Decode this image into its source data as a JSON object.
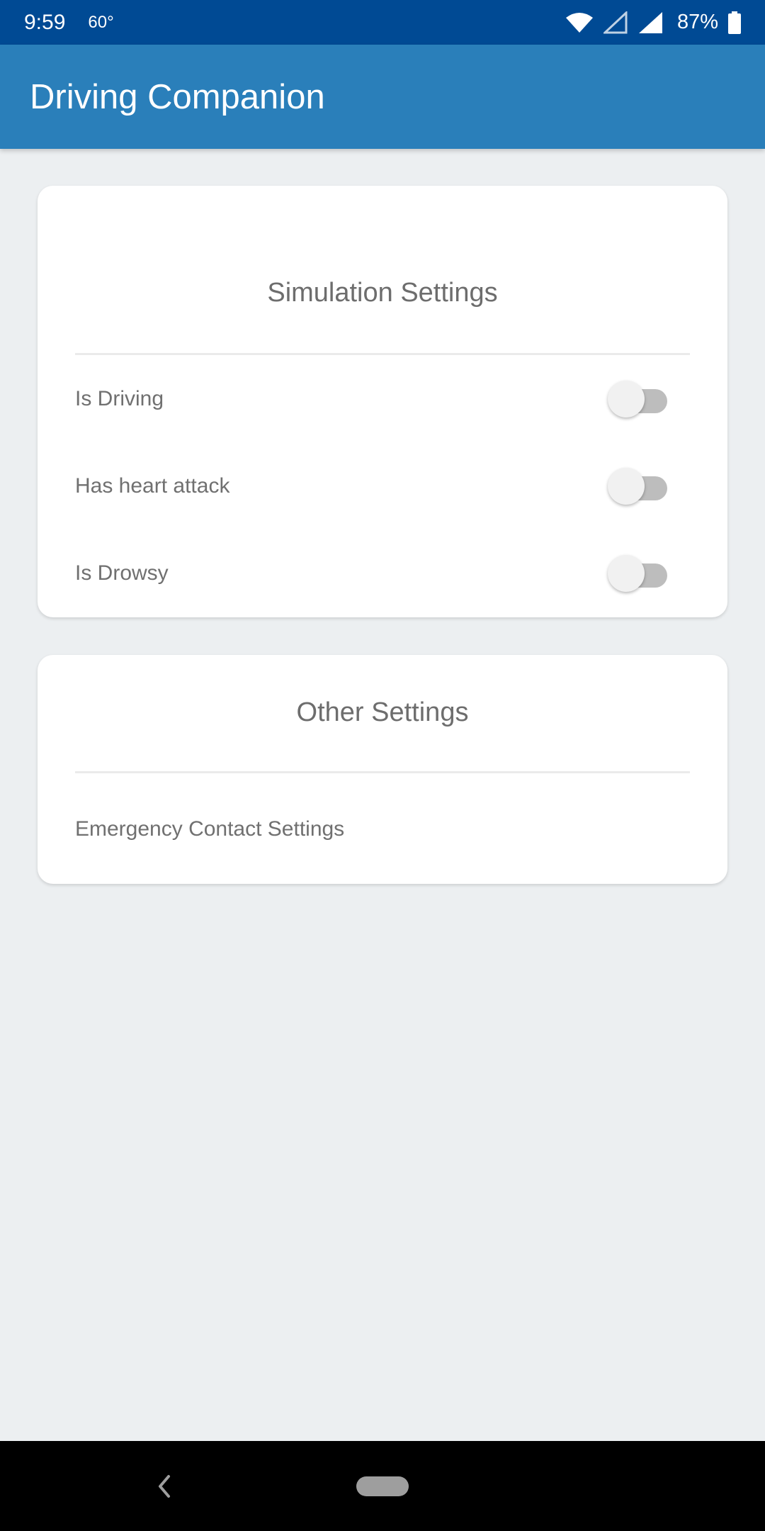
{
  "status_bar": {
    "time": "9:59",
    "temperature": "60°",
    "battery_percent": "87%",
    "icons": [
      "wifi-icon",
      "signal-empty-icon",
      "signal-icon",
      "battery-icon"
    ]
  },
  "app_bar": {
    "title": "Driving Companion",
    "color": "#2A7FBA"
  },
  "simulation_card": {
    "title": "Simulation Settings",
    "items": [
      {
        "label": "Is Driving",
        "enabled": false
      },
      {
        "label": "Has heart attack",
        "enabled": false
      },
      {
        "label": "Is Drowsy",
        "enabled": false
      }
    ]
  },
  "other_card": {
    "title": "Other Settings",
    "items": [
      {
        "label": "Emergency Contact Settings"
      }
    ]
  },
  "nav_bar": {
    "icons": [
      "back-icon",
      "home-pill-icon"
    ]
  }
}
